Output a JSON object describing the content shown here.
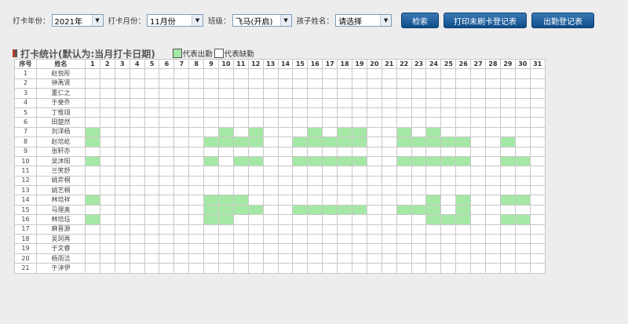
{
  "filters": {
    "year_label": "打卡年份：",
    "year_value": "2021年",
    "month_label": "打卡月份：",
    "month_value": "11月份",
    "class_label": "班级：",
    "class_value": "飞马(开启)",
    "child_label": "孩子姓名：",
    "child_value": "请选择"
  },
  "buttons": {
    "search": "检索",
    "print_unchecked": "打印未刷卡登记表",
    "attendance": "出勤登记表"
  },
  "section": {
    "title": "打卡统计(默认为:当月打卡日期)",
    "legend_present": "代表出勤",
    "legend_absent": "代表缺勤"
  },
  "colors": {
    "present": "#a5e8a5",
    "marker_red": "#c0392b",
    "marker_dark": "#555555",
    "button": "#1a5a96"
  },
  "table": {
    "col_index": "序号",
    "col_name": "姓名",
    "days": [
      "1",
      "2",
      "3",
      "4",
      "5",
      "6",
      "7",
      "8",
      "9",
      "10",
      "11",
      "12",
      "13",
      "14",
      "15",
      "16",
      "17",
      "18",
      "19",
      "20",
      "21",
      "22",
      "23",
      "24",
      "25",
      "26",
      "27",
      "28",
      "29",
      "30",
      "31"
    ],
    "rows": [
      {
        "no": "1",
        "name": "赵悦彤",
        "present": []
      },
      {
        "no": "2",
        "name": "钟禹贤",
        "present": []
      },
      {
        "no": "3",
        "name": "董仁之",
        "present": []
      },
      {
        "no": "4",
        "name": "于斐乔",
        "present": []
      },
      {
        "no": "5",
        "name": "丁惟翊",
        "present": []
      },
      {
        "no": "6",
        "name": "田楚然",
        "present": []
      },
      {
        "no": "7",
        "name": "刘洋杨",
        "present": [
          1,
          10,
          12,
          16,
          18,
          19,
          22,
          24
        ]
      },
      {
        "no": "8",
        "name": "赵培屹",
        "present": [
          1,
          9,
          10,
          11,
          12,
          15,
          16,
          17,
          18,
          19,
          22,
          23,
          24,
          25,
          26,
          29
        ]
      },
      {
        "no": "9",
        "name": "张轩亦",
        "present": []
      },
      {
        "no": "10",
        "name": "吴沐阳",
        "present": [
          1,
          9,
          11,
          12,
          15,
          16,
          17,
          18,
          19,
          22,
          23,
          24,
          25,
          26,
          29,
          30
        ]
      },
      {
        "no": "11",
        "name": "兰笑舒",
        "present": []
      },
      {
        "no": "12",
        "name": "姚弈桐",
        "present": []
      },
      {
        "no": "13",
        "name": "姚艺桐",
        "present": []
      },
      {
        "no": "14",
        "name": "林培祥",
        "present": [
          1,
          9,
          10,
          11,
          24,
          26,
          29,
          30
        ]
      },
      {
        "no": "15",
        "name": "马理奥",
        "present": [
          9,
          10,
          11,
          12,
          15,
          16,
          17,
          18,
          19,
          22,
          23,
          24,
          26
        ]
      },
      {
        "no": "16",
        "name": "林培珏",
        "present": [
          1,
          9,
          10,
          24,
          25,
          26,
          29,
          30
        ]
      },
      {
        "no": "17",
        "name": "麻晋源",
        "present": []
      },
      {
        "no": "18",
        "name": "吴珂再",
        "present": []
      },
      {
        "no": "19",
        "name": "于文睿",
        "present": []
      },
      {
        "no": "20",
        "name": "杨雨洁",
        "present": []
      },
      {
        "no": "21",
        "name": "于淳伊",
        "present": []
      }
    ]
  }
}
